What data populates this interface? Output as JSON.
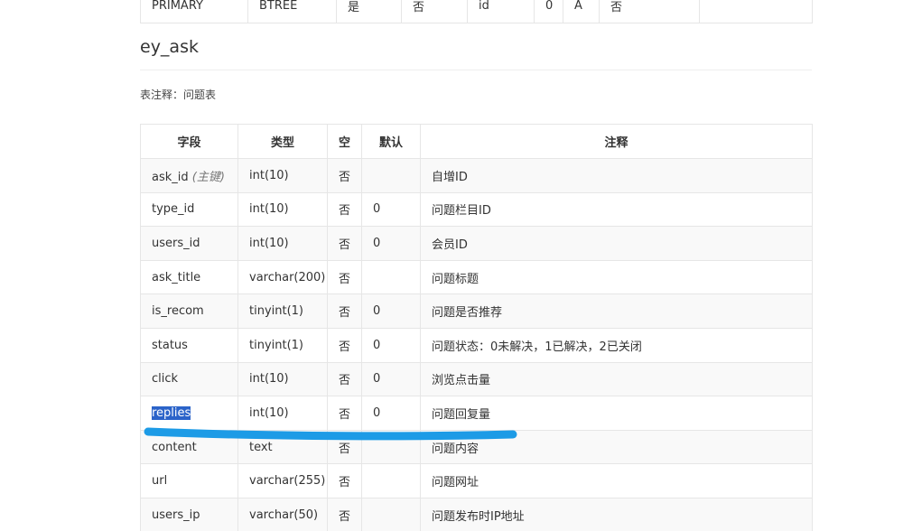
{
  "index_table": {
    "row": [
      "PRIMARY",
      "BTREE",
      "是",
      "否",
      "id",
      "0",
      "A",
      "否",
      ""
    ]
  },
  "section": {
    "title": "ey_ask",
    "comment_label": "表注释：",
    "comment_value": "问题表"
  },
  "fields_table": {
    "headers": {
      "field": "字段",
      "type": "类型",
      "null": "空",
      "default": "默认",
      "comment": "注释"
    },
    "rows": [
      {
        "field": "ask_id",
        "note": "(主键)",
        "type": "int(10)",
        "null": "否",
        "default": "",
        "comment": "自增ID"
      },
      {
        "field": "type_id",
        "note": "",
        "type": "int(10)",
        "null": "否",
        "default": "0",
        "comment": "问题栏目ID"
      },
      {
        "field": "users_id",
        "note": "",
        "type": "int(10)",
        "null": "否",
        "default": "0",
        "comment": "会员ID"
      },
      {
        "field": "ask_title",
        "note": "",
        "type": "varchar(200)",
        "null": "否",
        "default": "",
        "comment": "问题标题"
      },
      {
        "field": "is_recom",
        "note": "",
        "type": "tinyint(1)",
        "null": "否",
        "default": "0",
        "comment": "问题是否推荐"
      },
      {
        "field": "status",
        "note": "",
        "type": "tinyint(1)",
        "null": "否",
        "default": "0",
        "comment": "问题状态：0未解决，1已解决，2已关闭"
      },
      {
        "field": "click",
        "note": "",
        "type": "int(10)",
        "null": "否",
        "default": "0",
        "comment": "浏览点击量"
      },
      {
        "field": "replies",
        "note": "",
        "type": "int(10)",
        "null": "否",
        "default": "0",
        "comment": "问题回复量"
      },
      {
        "field": "content",
        "note": "",
        "type": "text",
        "null": "否",
        "default": "",
        "comment": "问题内容"
      },
      {
        "field": "url",
        "note": "",
        "type": "varchar(255)",
        "null": "否",
        "default": "",
        "comment": "问题网址"
      },
      {
        "field": "users_ip",
        "note": "",
        "type": "varchar(50)",
        "null": "否",
        "default": "",
        "comment": "问题发布时IP地址"
      }
    ]
  },
  "colors": {
    "selection": "#2b63c9",
    "annotation_stroke": "#1d9be6",
    "border": "#e6e6e6"
  }
}
